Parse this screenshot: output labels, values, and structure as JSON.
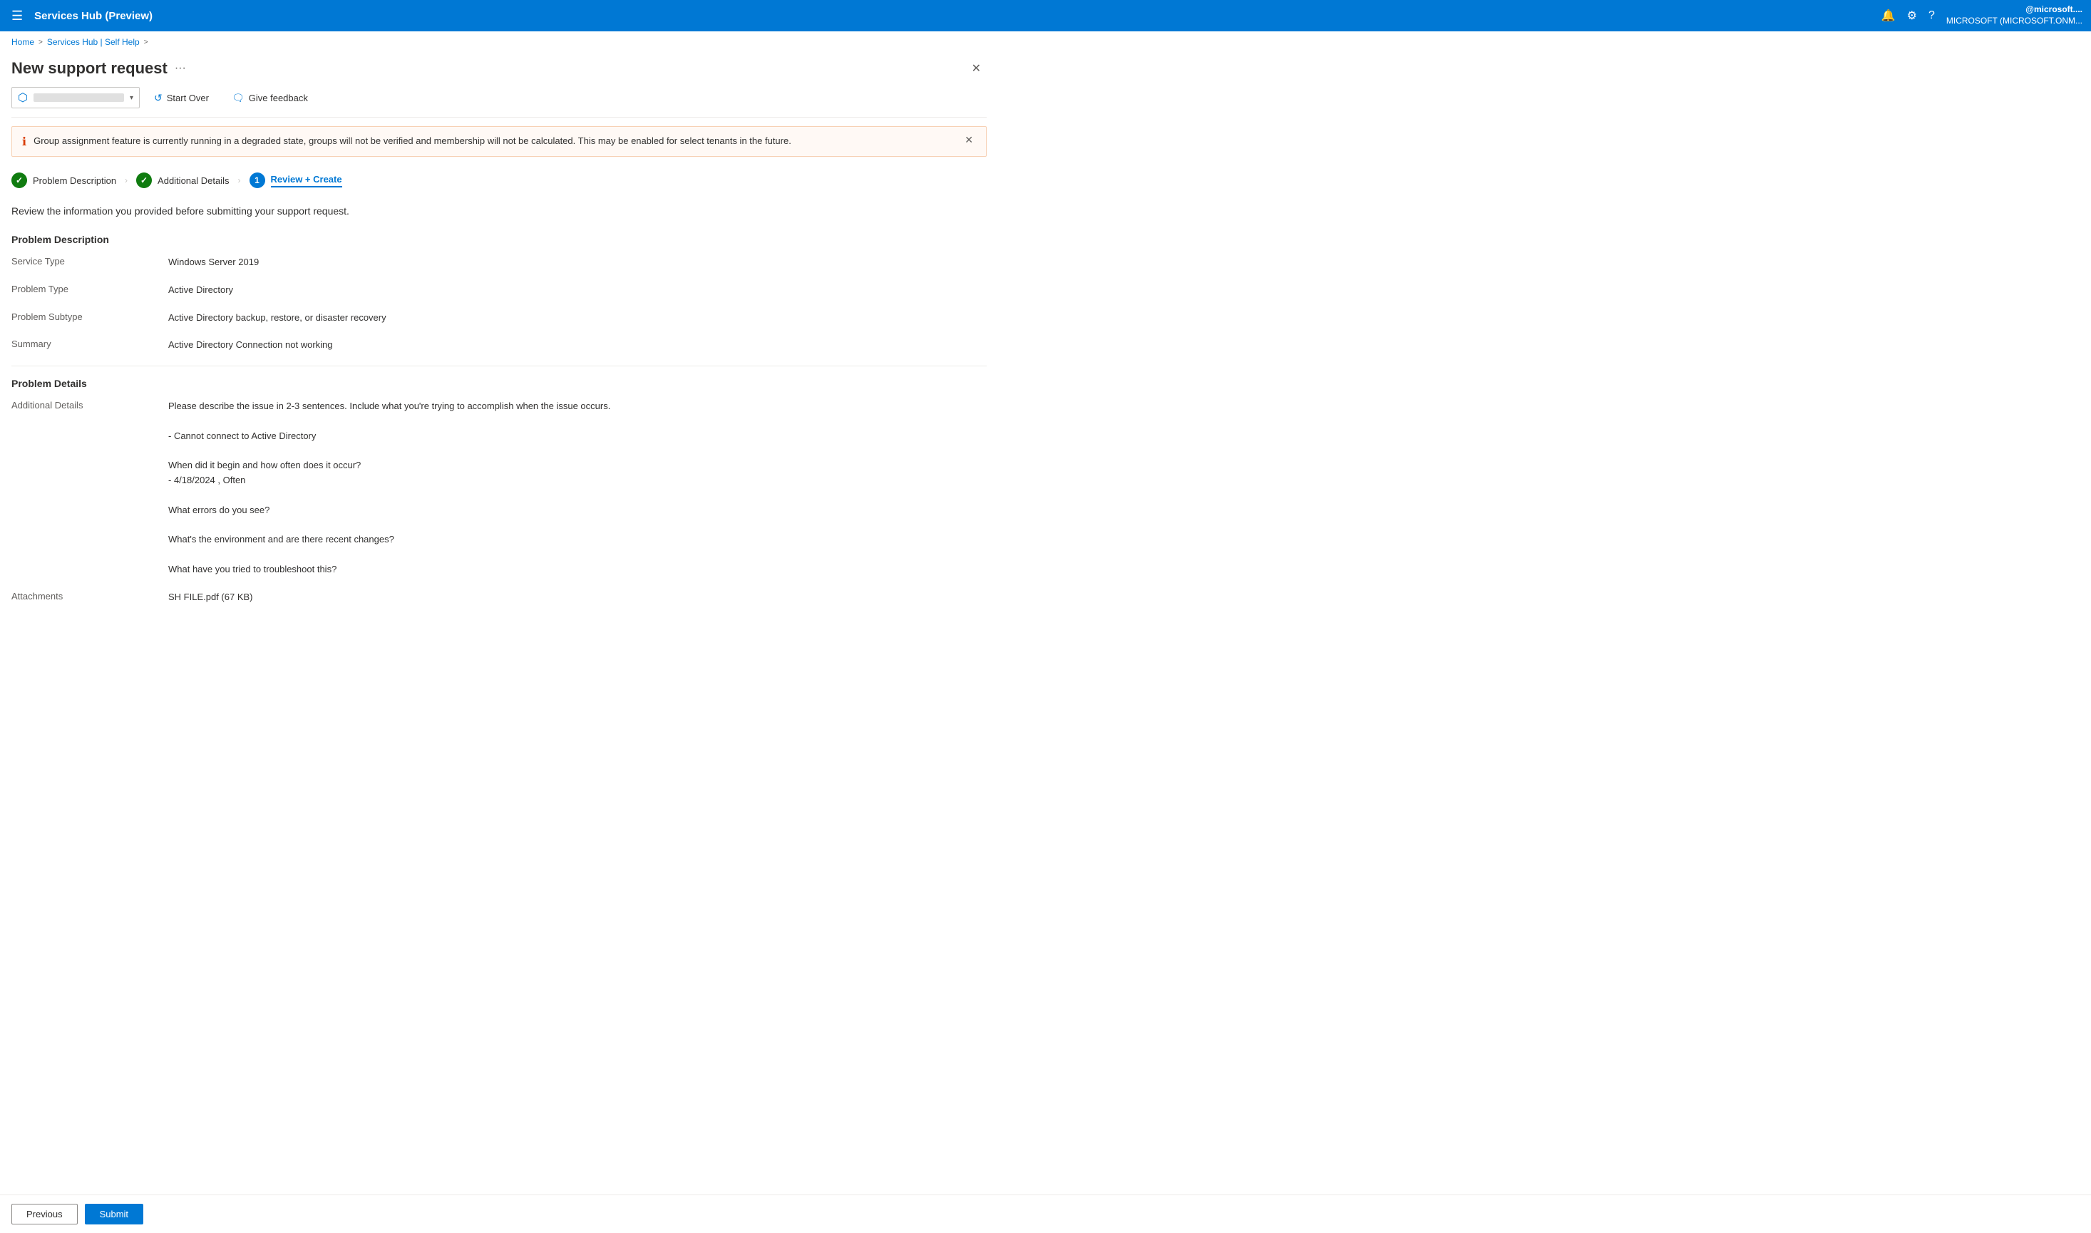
{
  "topbar": {
    "title": "Services Hub (Preview)",
    "menu_icon": "☰",
    "bell_icon": "🔔",
    "settings_icon": "⚙",
    "help_icon": "?",
    "user_line1": "@microsoft....",
    "user_line2": "MICROSOFT (MICROSOFT.ONM..."
  },
  "breadcrumb": {
    "home": "Home",
    "sep1": ">",
    "section": "Services Hub | Self Help",
    "sep2": ">"
  },
  "page": {
    "title": "New support request",
    "dots_label": "···"
  },
  "toolbar": {
    "group_placeholder": "",
    "start_over_label": "Start Over",
    "give_feedback_label": "Give feedback"
  },
  "alert": {
    "text": "Group assignment feature is currently running in a degraded state, groups will not be verified and membership will not be calculated. This may be enabled for select tenants in the future."
  },
  "steps": [
    {
      "id": "problem-description",
      "label": "Problem Description",
      "state": "completed",
      "number": "✓"
    },
    {
      "id": "additional-details",
      "label": "Additional Details",
      "state": "completed",
      "number": "✓"
    },
    {
      "id": "review-create",
      "label": "Review + Create",
      "state": "active",
      "number": "1"
    }
  ],
  "review": {
    "subtitle": "Review the information you provided before submitting your support request.",
    "problem_description_heading": "Problem Description",
    "fields_problem": [
      {
        "label": "Service Type",
        "value": "Windows Server 2019"
      },
      {
        "label": "Problem Type",
        "value": "Active Directory"
      },
      {
        "label": "Problem Subtype",
        "value": "Active Directory backup, restore, or disaster recovery"
      },
      {
        "label": "Summary",
        "value": "Active Directory Connection not working"
      }
    ],
    "problem_details_heading": "Problem Details",
    "additional_details_label": "Additional Details",
    "additional_details_lines": [
      "Please describe the issue in 2-3 sentences. Include what you're trying to accomplish when the issue occurs.",
      "",
      "- Cannot connect to Active Directory",
      "",
      "When did it begin and how often does it occur?",
      "- 4/18/2024 , Often",
      "",
      "What errors do you see?",
      "",
      "What's the environment and are there recent changes?",
      "",
      "What have you tried to troubleshoot this?"
    ],
    "attachments_label": "Attachments",
    "attachments_value": "SH FILE.pdf (67 KB)"
  },
  "footer": {
    "previous_label": "Previous",
    "submit_label": "Submit"
  }
}
